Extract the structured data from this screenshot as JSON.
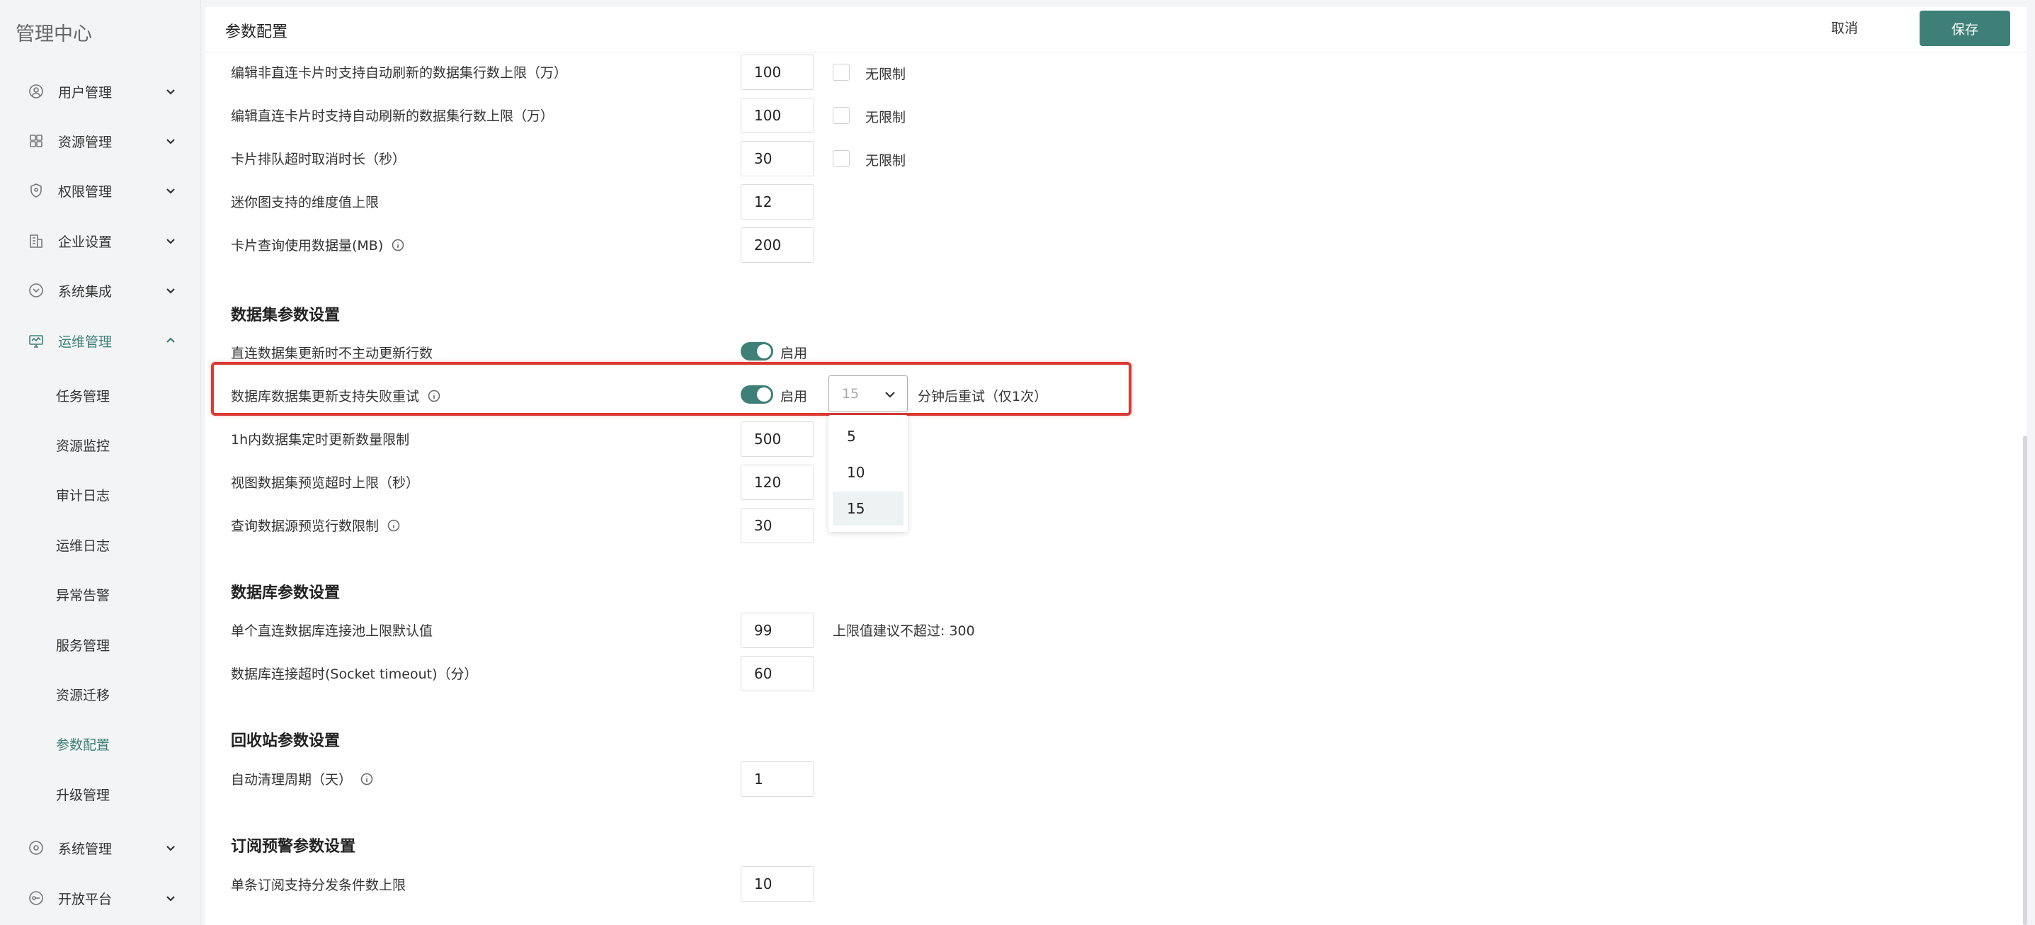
{
  "app": {
    "brand": "管理中心"
  },
  "sidebar": {
    "groups": [
      {
        "label": "用户管理",
        "icon": "user-icon",
        "expanded": false
      },
      {
        "label": "资源管理",
        "icon": "grid-icon",
        "expanded": false
      },
      {
        "label": "权限管理",
        "icon": "shield-icon",
        "expanded": false
      },
      {
        "label": "企业设置",
        "icon": "building-icon",
        "expanded": false
      },
      {
        "label": "系统集成",
        "icon": "integration-icon",
        "expanded": false
      },
      {
        "label": "运维管理",
        "icon": "monitor-icon",
        "expanded": true
      },
      {
        "label": "系统管理",
        "icon": "settings-icon",
        "expanded": false
      },
      {
        "label": "开放平台",
        "icon": "platform-icon",
        "expanded": false
      }
    ],
    "ops_items": [
      "任务管理",
      "资源监控",
      "审计日志",
      "运维日志",
      "异常告警",
      "服务管理",
      "资源迁移",
      "参数配置",
      "升级管理"
    ],
    "active_item": "参数配置"
  },
  "header": {
    "title": "参数配置",
    "cancel_label": "取消",
    "save_label": "保存"
  },
  "card_rows": [
    {
      "label": "编辑非直连卡片时支持自动刷新的数据集行数上限（万）",
      "value": "100",
      "unlimited_label": "无限制"
    },
    {
      "label": "编辑直连卡片时支持自动刷新的数据集行数上限（万）",
      "value": "100",
      "unlimited_label": "无限制"
    },
    {
      "label": "卡片排队超时取消时长（秒）",
      "value": "30",
      "unlimited_label": "无限制"
    },
    {
      "label": "迷你图支持的维度值上限",
      "value": "12"
    },
    {
      "label": "卡片查询使用数据量(MB)",
      "value": "200",
      "has_info": true
    }
  ],
  "dataset": {
    "title": "数据集参数设置",
    "direct_update": {
      "label": "直连数据集更新时不主动更新行数",
      "toggle_label": "启用",
      "enabled": true
    },
    "retry": {
      "label": "数据库数据集更新支持失败重试",
      "toggle_label": "启用",
      "enabled": true,
      "select_value": "15",
      "suffix": "分钟后重试（仅1次）",
      "options": [
        "5",
        "10",
        "15"
      ]
    },
    "rows": [
      {
        "label": "1h内数据集定时更新数量限制",
        "value": "500"
      },
      {
        "label": "视图数据集预览超时上限（秒）",
        "value": "120"
      },
      {
        "label": "查询数据源预览行数限制",
        "value": "30",
        "has_info": true
      }
    ]
  },
  "database": {
    "title": "数据库参数设置",
    "rows": [
      {
        "label": "单个直连数据库连接池上限默认值",
        "value": "99",
        "hint": "上限值建议不超过: 300"
      },
      {
        "label": "数据库连接超时(Socket timeout)（分）",
        "value": "60"
      }
    ]
  },
  "recycle": {
    "title": "回收站参数设置",
    "rows": [
      {
        "label": "自动清理周期（天）",
        "value": "1",
        "has_info": true
      }
    ]
  },
  "subscription": {
    "title": "订阅预警参数设置",
    "rows": [
      {
        "label": "单条订阅支持分发条件数上限",
        "value": "10"
      }
    ]
  },
  "colors": {
    "accent": "#3e8078",
    "highlight": "#d93a33"
  }
}
